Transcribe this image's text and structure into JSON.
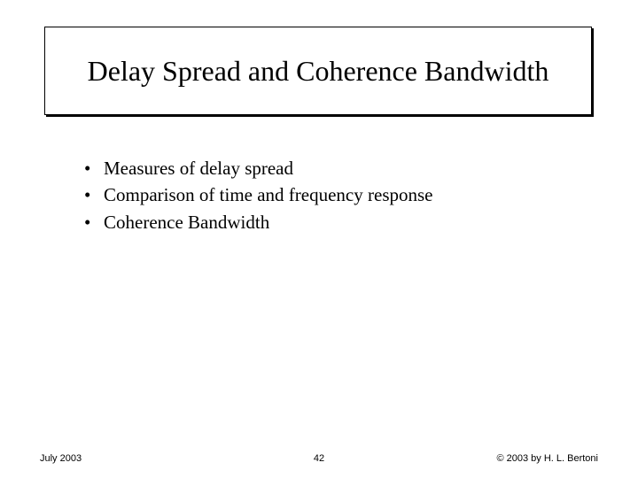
{
  "title": "Delay Spread and Coherence Bandwidth",
  "bullets": [
    "Measures of delay spread",
    "Comparison of time and frequency response",
    "Coherence Bandwidth"
  ],
  "footer": {
    "left": "July 2003",
    "center": "42",
    "right": "© 2003 by H. L. Bertoni"
  }
}
